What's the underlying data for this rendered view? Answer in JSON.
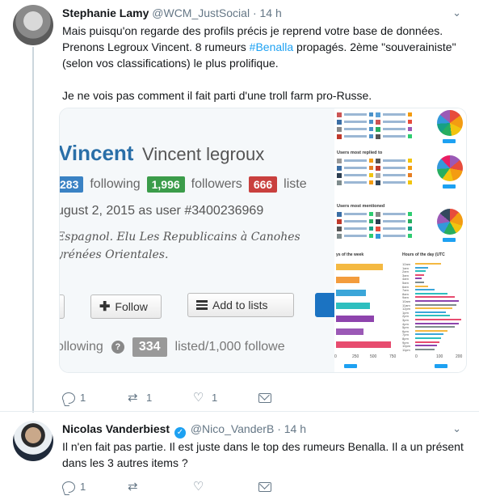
{
  "tweets": [
    {
      "name": "Stephanie Lamy",
      "handle": "@WCM_JustSocial",
      "dot": "·",
      "time": "14 h",
      "text_line1": "Mais puisqu'on regarde des profils précis je reprend votre base de données.",
      "text_line2a": "Prenons Legroux Vincent. 8 rumeurs ",
      "hashtag": "#Benalla",
      "text_line2b": " propagés. 2ème \"souverainiste\"",
      "text_line3": "(selon vos classifications) le plus prolifique.",
      "text_line4": "Je ne vois pas comment il fait parti d'une troll farm pro-Russe.",
      "actions": {
        "reply_count": "1",
        "retweet_count": "1",
        "like_count": "1"
      }
    },
    {
      "name": "Nicolas Vanderbiest",
      "verified": "✓",
      "handle": "@Nico_VanderB",
      "dot": "·",
      "time": "14 h",
      "text_line1": "Il n'en fait pas partie. Il est juste dans le top des rumeurs Benalla. Il a un présent",
      "text_line2": "dans les 3 autres items ?",
      "actions": {
        "reply_count": "1",
        "retweet_count": "",
        "like_count": ""
      }
    }
  ],
  "media": {
    "profile": {
      "name": "Vincent",
      "full_name": "Vincent legroux",
      "following_count": "283",
      "following_label": "following",
      "followers_count": "1,996",
      "followers_label": "followers",
      "listed_count": "666",
      "listed_label": "liste",
      "date_line": "ugust 2, 2015 as user #3400236969",
      "bio_line1": "Espagnol. Elu Les Republicains à Canohes",
      "bio_line2": "yrénées Orientales.",
      "follow_label": "Follow",
      "add_lists_label": "Add to lists",
      "following_footer": "ollowing",
      "listed_footer_count": "334",
      "listed_footer": "listed/1,000 followe"
    },
    "dashboard": {
      "section_replied": "Users most replied to",
      "section_mentioned": "Users most mentioned",
      "days_title": "ys of the week",
      "hours_title": "Hours of the day (UTC",
      "tweet_btn": "Tweet",
      "days_axis": [
        "0",
        "250",
        "500",
        "750"
      ],
      "hours_axis": [
        "0",
        "100",
        "200"
      ],
      "hour_labels": [
        "12am",
        "1am",
        "2am",
        "3am",
        "4am",
        "5am",
        "6am",
        "7am",
        "8am",
        "9am",
        "10am",
        "11am",
        "12pm",
        "1pm",
        "2pm",
        "3pm",
        "4pm",
        "5pm",
        "6pm",
        "7pm",
        "8pm",
        "9pm",
        "10pm",
        "11pm"
      ],
      "days_values": [
        560,
        280,
        360,
        400,
        450,
        330,
        650
      ],
      "days_colors": [
        "#f4b942",
        "#f39c3d",
        "#3ba6d9",
        "#2dbfbf",
        "#8e44ad",
        "#9b59b6",
        "#e74c6f"
      ]
    }
  },
  "colors": {
    "accent": "#1da1f2",
    "text": "#14171a",
    "muted": "#657786"
  }
}
